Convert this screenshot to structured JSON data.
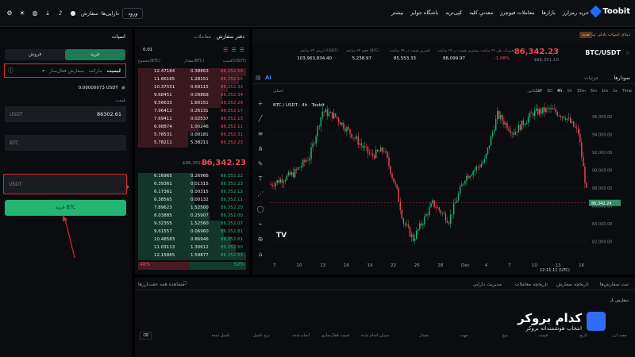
{
  "header": {
    "logo": "Toobit",
    "menu": [
      "خرید رمزارز",
      "بازارها",
      "معاملات فیوچرز",
      "معدنیِ کلید",
      "کپی‌ترید",
      "باشگاه جوایز",
      "بیشتر"
    ],
    "login": "ورود",
    "links": [
      "دارایی‌ها",
      "سفارش"
    ]
  },
  "order_panel": {
    "title": "اسپات",
    "buy_tab": "خرید",
    "sell_tab": "فروش",
    "type_limit": "لیمیت",
    "type_market": "مارکت",
    "type_more": "سفارش فعال‌ساز",
    "available": "0.00000073 USDT",
    "price_label": "قیمت",
    "price_currency": "USDT",
    "price_value": "86302.61",
    "amount_currency": "BTC",
    "total_currency": "USDT",
    "action_label": "خرید BTC"
  },
  "orderbook": {
    "tab_active": "دفتر سفارش",
    "tab_other": "معاملات",
    "precision": "0.01",
    "col_price": "قیمت(USDT)",
    "col_amount": "مقدار(BTC)",
    "col_total": "مجموع(BTC)",
    "mid_price": "86,342.23",
    "mid_sub": "$86,351.10",
    "buy_pct": "52%",
    "sell_pct": "48%",
    "asks": [
      {
        "price": "86,352.59",
        "amount": "0.38863",
        "total": "12.47184"
      },
      {
        "price": "86,352.55",
        "amount": "1.28151",
        "total": "11.66165"
      },
      {
        "price": "86,352.33",
        "amount": "0.69115",
        "total": "10.37551"
      },
      {
        "price": "86,352.34",
        "amount": "0.09868",
        "total": "9.68451"
      },
      {
        "price": "86,352.29",
        "amount": "1.60151",
        "total": "9.56633"
      },
      {
        "price": "86,352.17",
        "amount": "0.26131",
        "total": "7.96412"
      },
      {
        "price": "86,352.13",
        "amount": "0.02537",
        "total": "7.69411"
      },
      {
        "price": "86,352.11",
        "amount": "1.00246",
        "total": "6.98874"
      },
      {
        "price": "86,352.31",
        "amount": "0.00181",
        "total": "5.78531"
      },
      {
        "price": "86,352.23",
        "amount": "5.38211",
        "total": "5.78211"
      }
    ],
    "bids": [
      {
        "price": "86,352.22",
        "amount": "0.26966",
        "total": "6.16965"
      },
      {
        "price": "86,352.23",
        "amount": "0.01315",
        "total": "6.39361"
      },
      {
        "price": "86,352.12",
        "amount": "0.00315",
        "total": "6.17361"
      },
      {
        "price": "86,352.11",
        "amount": "0.00132",
        "total": "6.38565"
      },
      {
        "price": "86,352.20",
        "amount": "1.52500",
        "total": "7.89623"
      },
      {
        "price": "86,352.00",
        "amount": "0.25907",
        "total": "8.03885"
      },
      {
        "price": "86,352.07",
        "amount": "1.52560",
        "total": "9.32355"
      },
      {
        "price": "86,352.81",
        "amount": "0.06960",
        "total": "9.61557"
      },
      {
        "price": "86,352.61",
        "amount": "0.86946",
        "total": "10.48583"
      },
      {
        "price": "86,352.50",
        "amount": "1.30612",
        "total": "11.03113"
      },
      {
        "price": "86,352.53",
        "amount": "1.59877",
        "total": "12.15865"
      }
    ]
  },
  "ticker": {
    "symbol": "BTC/USDT",
    "price": "86,342.23",
    "price_sub": "$86,351.10",
    "change_label": "تغییرات طی ۲۴ ساعت",
    "change": "-1.08%",
    "high_label": "بیشترین قیمت در ۲۴ ساعت",
    "high": "88,099.97",
    "low_label": "کمترین قیمت در ۲۴ ساعت",
    "low": "85,553.33",
    "vol_btc_label": "حجم ۲۴ ساعته (BTC)",
    "vol_btc": "5,238.97",
    "vol_usdt_label": "ارزش ۲۴ ساعته (USDT)",
    "vol_usdt": "103,963,834.40",
    "banner": "دیتای اسپات بادلی تیکت",
    "banner_tag": "جدید"
  },
  "chart": {
    "tab_active": "نمودارها",
    "tab_other": "جزئیات",
    "intervals": [
      "Time",
      "1s",
      "1m",
      "5m",
      "15m",
      "1h",
      "4h",
      "1D",
      "1W"
    ],
    "view": "اصلی",
    "indicator": "اندیکاتور",
    "legend": "BTC / USDT · 4h · Toobit",
    "current_price_label": "86,342.24",
    "time_label": "12:11:11 (UTC)",
    "date_label": "Dec"
  },
  "chart_data": {
    "type": "candlestick",
    "x_ticks": [
      "7",
      "10",
      "13",
      "16",
      "19",
      "22",
      "25",
      "28",
      "Dec",
      "4",
      "7",
      "10",
      "13",
      "16"
    ],
    "y_ticks": [
      "96,000.00",
      "94,000.00",
      "92,000.00",
      "90,000.00",
      "88,000.00",
      "86,000.00",
      "84,000.00",
      "82,000.00"
    ],
    "ylim": [
      81000,
      97500
    ]
  },
  "bottom": {
    "tabs": [
      "ثبت سفارش‌ها",
      "تاریخچه سفارش",
      "تاریخچه معاملات",
      "مدیریت دارایی"
    ],
    "hide_pairs": "مشاهده همه جفت‌ارزها",
    "columns": [
      "جفت ارز",
      "تاریخ",
      "قیمت",
      "نوع",
      "جهت",
      "مقدار",
      "میزان انجام شده",
      "قیمت فعال‌سازی",
      "انجام شده",
      "نرخ تکمیل",
      "تکمیل شده"
    ],
    "filter": "سفارش باز"
  },
  "watermark": {
    "title": "کدام بروکر",
    "subtitle": "انتخاب هوشمندانه بروکر"
  }
}
